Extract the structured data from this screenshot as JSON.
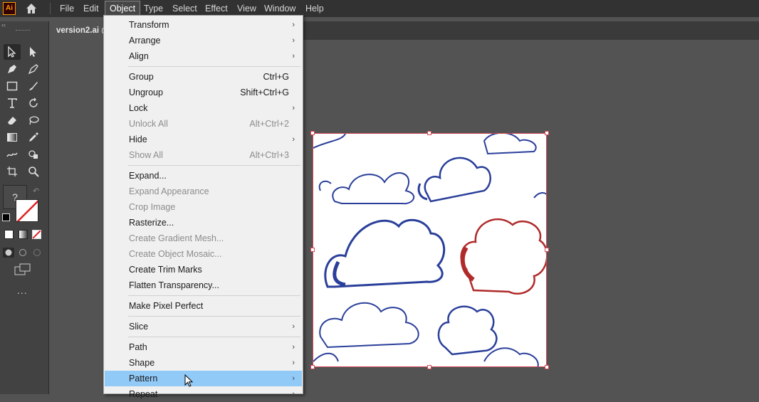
{
  "app": {
    "logo_text": "Ai"
  },
  "menubar": {
    "items": [
      "File",
      "Edit",
      "Object",
      "Type",
      "Select",
      "Effect",
      "View",
      "Window",
      "Help"
    ],
    "active": "Object"
  },
  "document": {
    "tab_title": "version2.ai @"
  },
  "toolbar": {
    "unknown_fill_label": "?",
    "more_label": "..."
  },
  "object_menu": [
    {
      "label": "Transform",
      "submenu": true
    },
    {
      "label": "Arrange",
      "submenu": true
    },
    {
      "label": "Align",
      "submenu": true
    },
    {
      "sep": true
    },
    {
      "label": "Group",
      "shortcut": "Ctrl+G"
    },
    {
      "label": "Ungroup",
      "shortcut": "Shift+Ctrl+G"
    },
    {
      "label": "Lock",
      "submenu": true
    },
    {
      "label": "Unlock All",
      "shortcut": "Alt+Ctrl+2",
      "disabled": true
    },
    {
      "label": "Hide",
      "submenu": true
    },
    {
      "label": "Show All",
      "shortcut": "Alt+Ctrl+3",
      "disabled": true
    },
    {
      "sep": true
    },
    {
      "label": "Expand..."
    },
    {
      "label": "Expand Appearance",
      "disabled": true
    },
    {
      "label": "Crop Image",
      "disabled": true
    },
    {
      "label": "Rasterize..."
    },
    {
      "label": "Create Gradient Mesh...",
      "disabled": true
    },
    {
      "label": "Create Object Mosaic...",
      "disabled": true
    },
    {
      "label": "Create Trim Marks"
    },
    {
      "label": "Flatten Transparency..."
    },
    {
      "sep": true
    },
    {
      "label": "Make Pixel Perfect"
    },
    {
      "sep": true
    },
    {
      "label": "Slice",
      "submenu": true
    },
    {
      "sep": true
    },
    {
      "label": "Path",
      "submenu": true
    },
    {
      "label": "Shape",
      "submenu": true
    },
    {
      "label": "Pattern",
      "submenu": true,
      "highlighted": true
    },
    {
      "label": "Repeat",
      "submenu": true
    }
  ],
  "colors": {
    "accent_highlight": "#91c9f7",
    "selection": "#d24a57",
    "cloud_blue": "#2a3f9a",
    "cloud_red": "#b02a2a"
  }
}
